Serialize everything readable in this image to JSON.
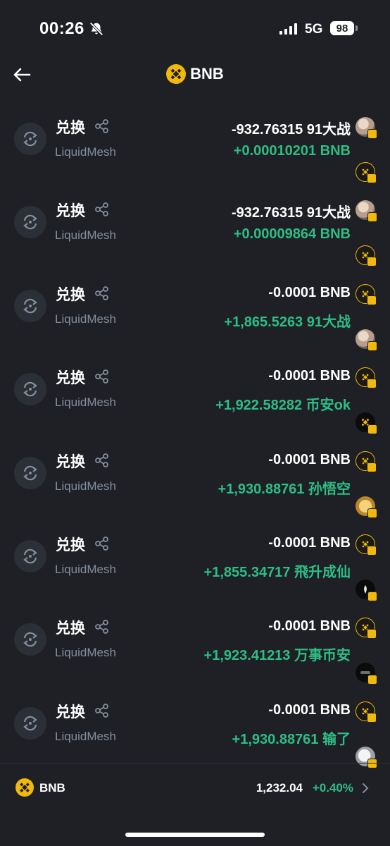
{
  "status_bar": {
    "time": "00:26",
    "network": "5G",
    "battery": "98"
  },
  "header": {
    "title": "BNB"
  },
  "transactions": [
    {
      "title": "兑换",
      "subtitle": "LiquidMesh",
      "amount_out": "-932.76315 91大战",
      "amount_in": "+0.00010201 BNB",
      "out_token": "91大战",
      "in_token": "BNB"
    },
    {
      "title": "兑换",
      "subtitle": "LiquidMesh",
      "amount_out": "-932.76315 91大战",
      "amount_in": "+0.00009864 BNB",
      "out_token": "91大战",
      "in_token": "BNB"
    },
    {
      "title": "兑换",
      "subtitle": "LiquidMesh",
      "amount_out": "-0.0001 BNB",
      "amount_in": "+1,865.5263 91大战",
      "out_token": "BNB",
      "in_token": "91大战"
    },
    {
      "title": "兑换",
      "subtitle": "LiquidMesh",
      "amount_out": "-0.0001 BNB",
      "amount_in": "+1,922.58282 币安ok",
      "out_token": "BNB",
      "in_token": "币安ok"
    },
    {
      "title": "兑换",
      "subtitle": "LiquidMesh",
      "amount_out": "-0.0001 BNB",
      "amount_in": "+1,930.88761 孙悟空",
      "out_token": "BNB",
      "in_token": "孙悟空"
    },
    {
      "title": "兑换",
      "subtitle": "LiquidMesh",
      "amount_out": "-0.0001 BNB",
      "amount_in": "+1,855.34717 飛升成仙",
      "out_token": "BNB",
      "in_token": "飛升成仙"
    },
    {
      "title": "兑换",
      "subtitle": "LiquidMesh",
      "amount_out": "-0.0001 BNB",
      "amount_in": "+1,923.41213 万事币安",
      "out_token": "BNB",
      "in_token": "万事币安"
    },
    {
      "title": "兑换",
      "subtitle": "LiquidMesh",
      "amount_out": "-0.0001 BNB",
      "amount_in": "+1,930.88761 输了",
      "out_token": "BNB",
      "in_token": "输了"
    }
  ],
  "footer": {
    "token": "BNB",
    "price": "1,232.04",
    "change": "+0.40%"
  },
  "colors": {
    "background": "#1e2026",
    "positive": "#2ebd85",
    "muted": "#848e9c",
    "bnb": "#f0b90b"
  },
  "icons": {
    "back": "arrow-left-icon",
    "swap": "swap-icon",
    "share": "share-icon",
    "bnb": "bnb-coin-icon",
    "chevron": "chevron-right-icon",
    "mute": "bell-slash-icon"
  }
}
